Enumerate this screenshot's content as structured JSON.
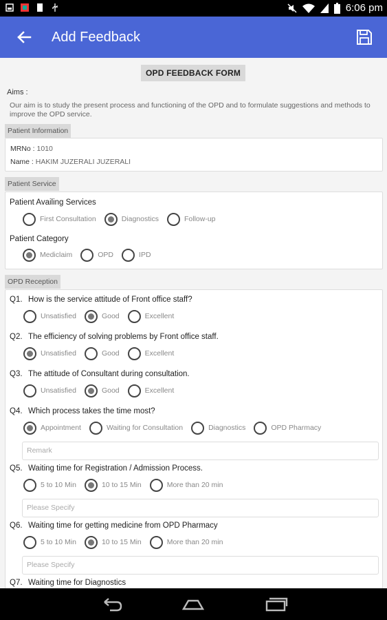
{
  "status_bar": {
    "time": "6:06 pm",
    "icons": [
      "screenshot-icon",
      "app-icon",
      "sd-card-icon",
      "usb-icon",
      "mute-icon",
      "wifi-icon",
      "signal-icon",
      "battery-icon"
    ]
  },
  "app_bar": {
    "title": "Add Feedback",
    "back_icon": "arrow-left-icon",
    "save_icon": "save-icon"
  },
  "form": {
    "title": "OPD FEEDBACK FORM",
    "aims_label": "Aims :",
    "aims_text": "Our aim is to study the present process and functioning of the OPD and to formulate suggestions and methods to improve the OPD service."
  },
  "patient_info": {
    "header": "Patient Information",
    "mrn_label": "MRNo : ",
    "mrn_value": "1010",
    "name_label": "Name : ",
    "name_value": "HAKIM JUZERALI JUZERALI"
  },
  "patient_service": {
    "header": "Patient Service",
    "availing_label": "Patient Availing Services",
    "availing_options": [
      "First Consultation",
      "Diagnostics",
      "Follow-up"
    ],
    "availing_selected": "Diagnostics",
    "category_label": "Patient Category",
    "category_options": [
      "Mediclaim",
      "OPD",
      "IPD"
    ],
    "category_selected": "Mediclaim"
  },
  "opd_reception": {
    "header": "OPD Reception",
    "questions": [
      {
        "num": "Q1.",
        "text": "How is the service attitude of Front office staff?",
        "options": [
          "Unsatisfied",
          "Good",
          "Excellent"
        ],
        "selected": "Good"
      },
      {
        "num": "Q2.",
        "text": "The efficiency of solving problems by Front office staff.",
        "options": [
          "Unsatisfied",
          "Good",
          "Excellent"
        ],
        "selected": "Unsatisfied"
      },
      {
        "num": "Q3.",
        "text": "The attitude of Consultant during consultation.",
        "options": [
          "Unsatisfied",
          "Good",
          "Excellent"
        ],
        "selected": "Good"
      },
      {
        "num": "Q4.",
        "text": "Which process takes the time most?",
        "options": [
          "Appointment",
          "Waiting for Consultation",
          "Diagnostics",
          "OPD Pharmacy"
        ],
        "selected": "Appointment",
        "field_placeholder": "Remark"
      },
      {
        "num": "Q5.",
        "text": "Waiting time for Registration / Admission Process.",
        "options": [
          "5 to 10 Min",
          "10 to 15 Min",
          "More than 20 min"
        ],
        "selected": "10 to 15 Min",
        "field_placeholder": "Please Specify"
      },
      {
        "num": "Q6.",
        "text": "Waiting time for getting medicine from OPD Pharmacy",
        "options": [
          "5 to 10 Min",
          "10 to 15 Min",
          "More than 20 min"
        ],
        "selected": "10 to 15 Min",
        "field_placeholder": "Please Specify"
      },
      {
        "num": "Q7.",
        "text": "Waiting time for Diagnostics"
      }
    ]
  },
  "nav_bar": {
    "icons": [
      "back-icon",
      "home-icon",
      "recents-icon"
    ]
  }
}
